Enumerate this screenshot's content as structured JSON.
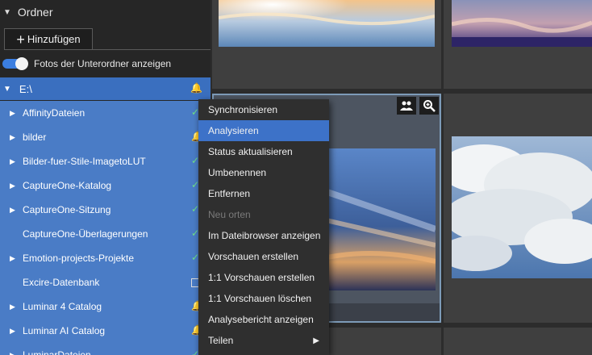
{
  "panel": {
    "section_title": "Ordner",
    "add_button": "Hinzufügen",
    "toggle_label": "Fotos der Unterordner anzeigen",
    "toggle_on": true
  },
  "tree": {
    "root": "E:\\",
    "items": [
      {
        "label": "AffinityDateien",
        "expandable": true,
        "status": "check"
      },
      {
        "label": "bilder",
        "expandable": true,
        "status": "bell"
      },
      {
        "label": "Bilder-fuer-Stile-ImagetoLUT",
        "expandable": true,
        "status": "check"
      },
      {
        "label": "CaptureOne-Katalog",
        "expandable": true,
        "status": "check"
      },
      {
        "label": "CaptureOne-Sitzung",
        "expandable": true,
        "status": "check"
      },
      {
        "label": "CaptureOne-Überlagerungen",
        "expandable": false,
        "status": "check"
      },
      {
        "label": "Emotion-projects-Projekte",
        "expandable": true,
        "status": "check"
      },
      {
        "label": "Excire-Datenbank",
        "expandable": false,
        "status": "box"
      },
      {
        "label": "Luminar 4 Catalog",
        "expandable": true,
        "status": "bell"
      },
      {
        "label": "Luminar AI Catalog",
        "expandable": true,
        "status": "bell"
      },
      {
        "label": "LuminarDateien",
        "expandable": true,
        "status": "check"
      }
    ]
  },
  "context_menu": {
    "items": [
      {
        "label": "Synchronisieren",
        "state": "normal"
      },
      {
        "label": "Analysieren",
        "state": "active"
      },
      {
        "label": "Status aktualisieren",
        "state": "normal"
      },
      {
        "label": "Umbenennen",
        "state": "normal"
      },
      {
        "label": "Entfernen",
        "state": "normal"
      },
      {
        "label": "Neu orten",
        "state": "disabled"
      },
      {
        "label": "Im Dateibrowser anzeigen",
        "state": "normal"
      },
      {
        "label": "Vorschauen erstellen",
        "state": "normal"
      },
      {
        "label": "1:1 Vorschauen erstellen",
        "state": "normal"
      },
      {
        "label": "1:1 Vorschauen löschen",
        "state": "normal"
      },
      {
        "label": "Analysebericht anzeigen",
        "state": "normal"
      },
      {
        "label": "Teilen",
        "state": "normal",
        "submenu": true
      }
    ]
  },
  "icons": {
    "section_caret": "triangle-down-icon",
    "add": "plus-icon",
    "people": "people-icon",
    "zoom": "zoom-in-icon",
    "bell": "bell-icon",
    "check": "check-icon"
  },
  "colors": {
    "accent": "#3d72c8",
    "tree_background": "#4a7cc6",
    "check": "#6ee08a",
    "bell": "#e3cc66"
  }
}
